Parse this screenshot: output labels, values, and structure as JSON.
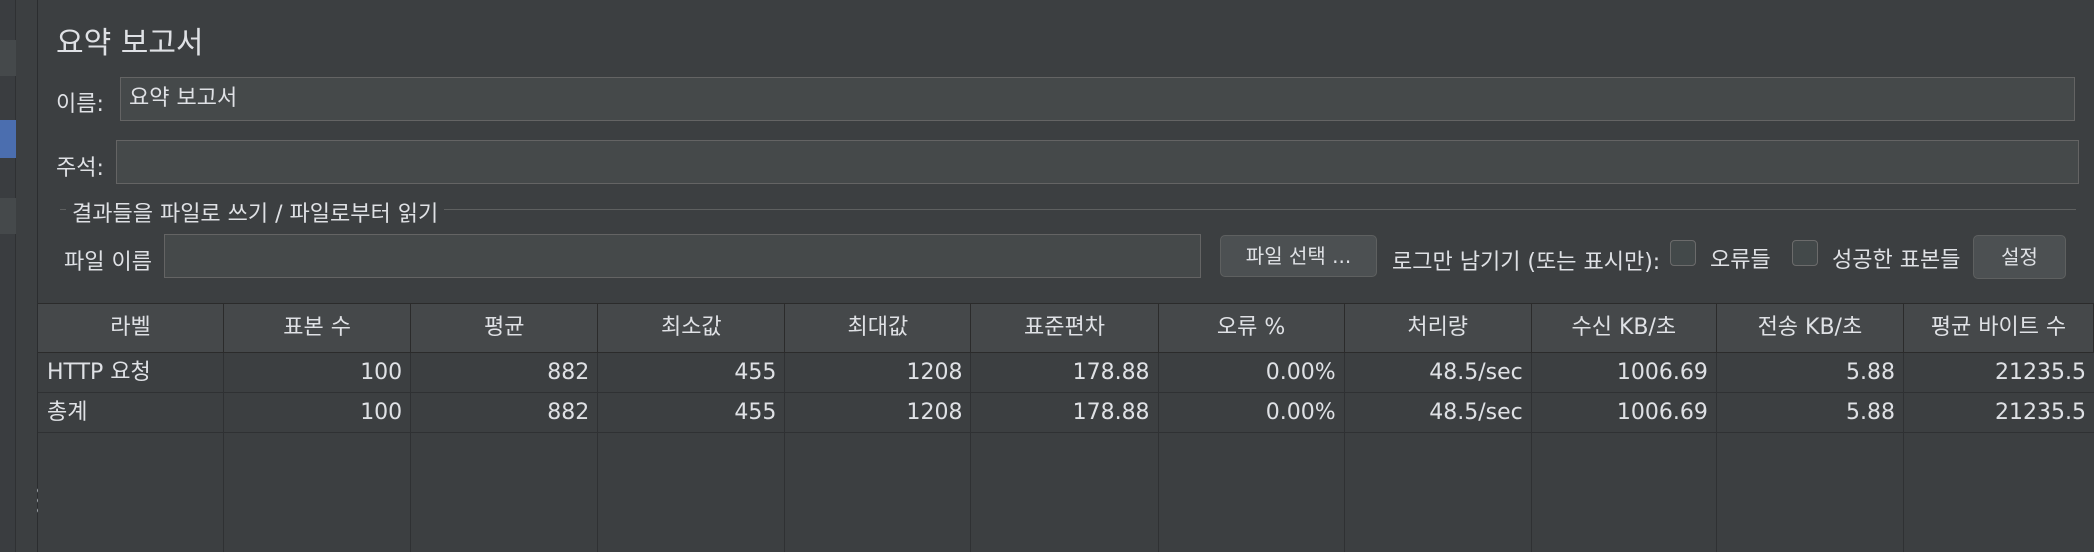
{
  "title": "요약 보고서",
  "name": {
    "label": "이름:",
    "value": "요약 보고서"
  },
  "comment": {
    "label": "주석:",
    "value": ""
  },
  "file_group": {
    "title": "결과들을 파일로 쓰기 / 파일로부터 읽기",
    "filename_label": "파일 이름",
    "filename_value": "",
    "browse_button": "파일 선택 ...",
    "log_only_label": "로그만 남기기 (또는 표시만):",
    "errors_label": "오류들",
    "errors_checked": false,
    "successes_label": "성공한 표본들",
    "successes_checked": false,
    "configure_button": "설정"
  },
  "table": {
    "columns": [
      "라벨",
      "표본 수",
      "평균",
      "최소값",
      "최대값",
      "표준편차",
      "오류 %",
      "처리량",
      "수신 KB/초",
      "전송 KB/초",
      "평균 바이트 수"
    ],
    "rows": [
      [
        "HTTP 요청",
        "100",
        "882",
        "455",
        "1208",
        "178.88",
        "0.00%",
        "48.5/sec",
        "1006.69",
        "5.88",
        "21235.5"
      ],
      [
        "총계",
        "100",
        "882",
        "455",
        "1208",
        "178.88",
        "0.00%",
        "48.5/sec",
        "1006.69",
        "5.88",
        "21235.5"
      ]
    ]
  }
}
